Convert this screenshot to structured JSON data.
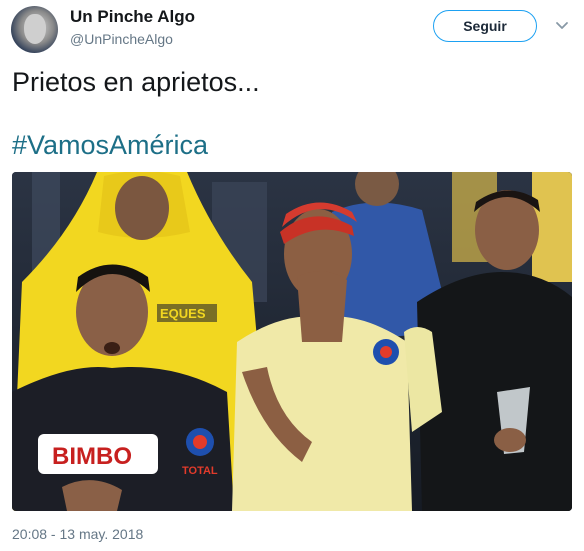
{
  "tweet": {
    "display_name": "Un Pinche Algo",
    "handle": "@UnPincheAlgo",
    "follow_label": "Seguir",
    "text": "Prietos en aprietos...",
    "hashtag": "#VamosAmérica",
    "timestamp": "20:08 - 13 may. 2018"
  },
  "photo": {
    "jersey_sponsor": "BIMBO",
    "secondary_sponsor": "TOTAL",
    "raincoat_text": "EQUES"
  },
  "colors": {
    "accent": "#1da1f2",
    "hashtag": "#1d6f87",
    "secondary_text": "#657786"
  },
  "icons": [
    "avatar",
    "chevron-down-icon"
  ]
}
